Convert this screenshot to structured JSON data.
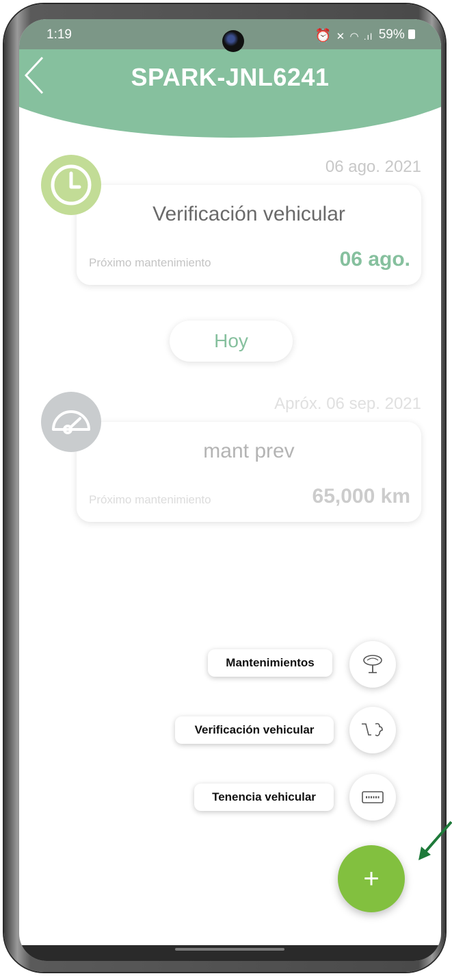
{
  "status_bar": {
    "time": "1:19",
    "icons": "⏰ ✕ 📶 .ıl",
    "battery": "59%"
  },
  "header": {
    "title": "SPARK-JNL6241",
    "color": "#86c09e"
  },
  "timeline": [
    {
      "date": "06 ago. 2021",
      "title": "Verificación vehicular",
      "subtitle": "Próximo mantenimiento",
      "value": "06 ago.",
      "icon": "clock-icon",
      "state": "active"
    },
    {
      "date": "Apróx. 06 sep. 2021",
      "title": "mant prev",
      "subtitle": "Próximo mantenimiento",
      "value": "65,000 km",
      "icon": "speedometer-icon",
      "state": "upcoming"
    }
  ],
  "today_label": "Hoy",
  "fab_menu": {
    "items": [
      {
        "label": "Mantenimientos",
        "icon": "tree-icon"
      },
      {
        "label": "Verificación vehicular",
        "icon": "exhaust-icon"
      },
      {
        "label": "Tenencia vehicular",
        "icon": "license-plate-icon"
      }
    ],
    "main_label": "+",
    "accent": "#82c03f"
  }
}
